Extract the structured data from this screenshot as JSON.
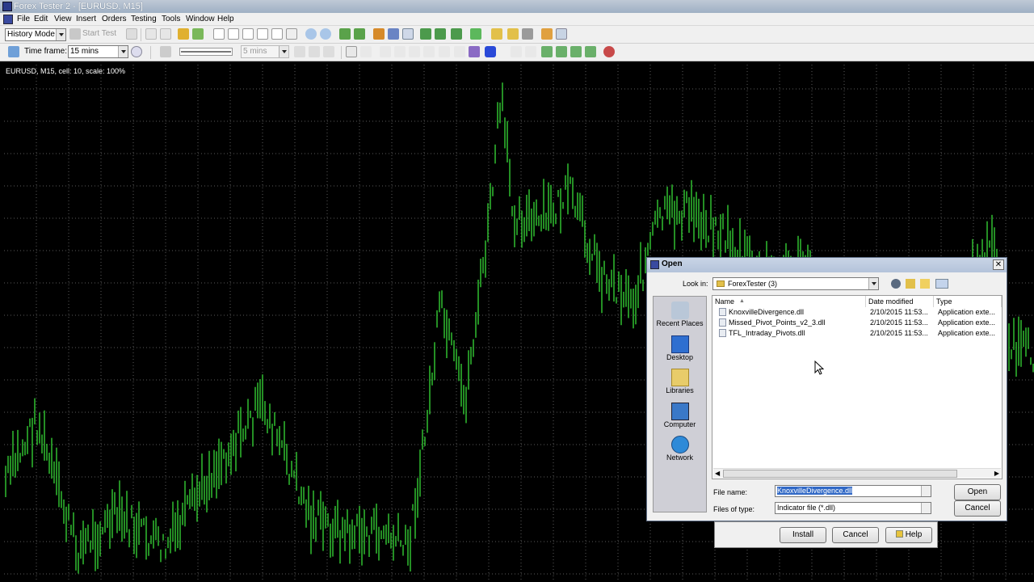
{
  "window": {
    "title": "Forex Tester 2 - [EURUSD, M15]"
  },
  "menu": [
    "File",
    "Edit",
    "View",
    "Insert",
    "Orders",
    "Testing",
    "Tools",
    "Window",
    "Help"
  ],
  "toolbar1": {
    "mode": "History Mode",
    "start_test": "Start Test"
  },
  "toolbar2": {
    "timeframe_label": "Time frame:",
    "timeframe_value": "15 mins",
    "step_value": "5 mins"
  },
  "chart": {
    "label": "EURUSD, M15, cell: 10, scale: 100%",
    "grid_color": "#5a5a5a",
    "candle_color": "#33cc33"
  },
  "open_dialog": {
    "title": "Open",
    "look_in_label": "Look in:",
    "look_in_value": "ForexTester (3)",
    "places": [
      "Recent Places",
      "Desktop",
      "Libraries",
      "Computer",
      "Network"
    ],
    "columns": [
      "Name",
      "Date modified",
      "Type"
    ],
    "files": [
      {
        "name": "KnoxvilleDivergence.dll",
        "date": "2/10/2015 11:53...",
        "type": "Application exte..."
      },
      {
        "name": "Missed_Pivot_Points_v2_3.dll",
        "date": "2/10/2015 11:53...",
        "type": "Application exte..."
      },
      {
        "name": "TFL_Intraday_Pivots.dll",
        "date": "2/10/2015 11:53...",
        "type": "Application exte..."
      }
    ],
    "file_name_label": "File name:",
    "file_name_value": "KnoxvilleDivergence.dll",
    "files_of_type_label": "Files of type:",
    "files_of_type_value": "Indicator file (*.dll)",
    "open_button": "Open",
    "cancel_button": "Cancel"
  },
  "install_dialog": {
    "install_button": "Install",
    "cancel_button": "Cancel",
    "help_button": "Help"
  }
}
